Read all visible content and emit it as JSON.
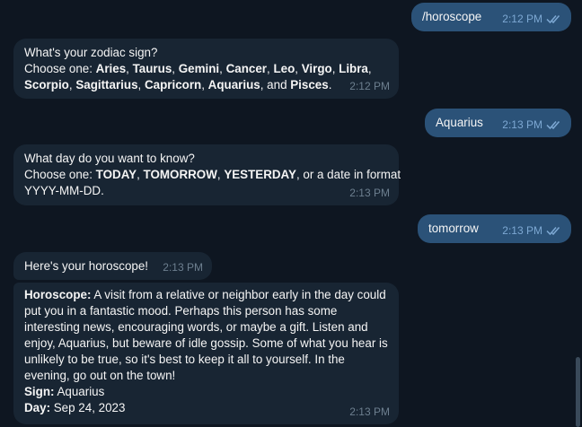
{
  "messages": [
    {
      "id": "m1",
      "direction": "out",
      "text": "/horoscope",
      "time": "2:12 PM",
      "read": true
    },
    {
      "id": "m2",
      "direction": "in",
      "line1": "What's your zodiac sign?",
      "line2_prefix": "Choose one: ",
      "signs_line2": [
        "Aries",
        "Taurus",
        "Gemini",
        "Cancer",
        "Leo",
        "Virgo",
        "Libra"
      ],
      "signs_line3": [
        "Scorpio",
        "Sagittarius",
        "Capricorn",
        "Aquarius"
      ],
      "and_word": "and",
      "last_sign": "Pisces",
      "time": "2:12 PM"
    },
    {
      "id": "m3",
      "direction": "out",
      "text": "Aquarius",
      "time": "2:13 PM",
      "read": true
    },
    {
      "id": "m4",
      "direction": "in",
      "line1": "What day do you want to know?",
      "line2_prefix": "Choose one: ",
      "opt1": "TODAY",
      "opt2": "TOMORROW",
      "opt3": "YESTERDAY",
      "line2_suffix": ", or a date in format",
      "line3": "YYYY-MM-DD.",
      "time": "2:13 PM"
    },
    {
      "id": "m5",
      "direction": "out",
      "text": "tomorrow",
      "time": "2:13 PM",
      "read": true
    },
    {
      "id": "m6",
      "direction": "in",
      "text": "Here's your horoscope!",
      "time": "2:13 PM"
    },
    {
      "id": "m7",
      "direction": "in",
      "horoscope_label": "Horoscope:",
      "horoscope_lines": [
        " A visit from a relative or neighbor early in the day could",
        "put you in a fantastic mood. Perhaps this person has some",
        "interesting news, encouraging words, or maybe a gift. Listen and",
        "enjoy, Aquarius, but beware of idle gossip. Some of what you hear is",
        "unlikely to be true, so it's best to keep it all to yourself. In the",
        "evening, go out on the town!"
      ],
      "sign_label": "Sign:",
      "sign_value": " Aquarius",
      "day_label": "Day:",
      "day_value": " Sep 24, 2023",
      "time": "2:13 PM"
    }
  ],
  "icons": {
    "read_receipt": "double-check-icon"
  },
  "colors": {
    "background": "#0e1621",
    "incoming_bubble": "#182533",
    "outgoing_bubble": "#2b5278",
    "text": "#f5f5f5",
    "incoming_time": "#6d7f8f",
    "outgoing_time": "#7da8d3"
  }
}
